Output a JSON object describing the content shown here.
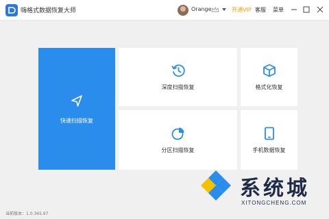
{
  "window": {
    "title": "嗨格式数据恢复大师",
    "username": "Orange",
    "vip_label": "开通VIP",
    "service_label": "客服",
    "menu_label": "菜单"
  },
  "tiles": {
    "quick": {
      "label": "快速扫描恢复",
      "icon": "navigation-arrow-icon"
    },
    "deep": {
      "label": "深度扫描恢复",
      "icon": "clock-history-icon"
    },
    "format": {
      "label": "格式化恢复",
      "icon": "cube-icon"
    },
    "partition": {
      "label": "分区扫描恢复",
      "icon": "pie-chart-icon"
    },
    "phone": {
      "label": "手机数据恢复",
      "icon": "tablet-icon"
    }
  },
  "footer": {
    "version": "当前版本：1.0.365.97"
  },
  "watermark": {
    "text": "系统城",
    "url": "XITONGCHENG.COM"
  },
  "colors": {
    "accent": "#2a8ceb",
    "vip": "#f2a000",
    "background": "#f0f0f0"
  }
}
